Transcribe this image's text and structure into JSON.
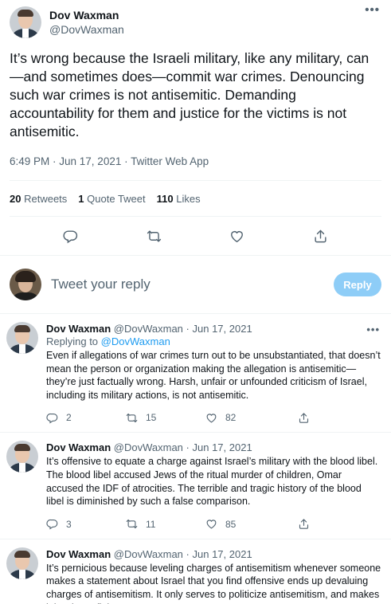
{
  "main_tweet": {
    "display_name": "Dov Waxman",
    "handle": "@DovWaxman",
    "more_label": "•••",
    "text": "It’s wrong because the Israeli military, like any military, can—and sometimes does—commit war crimes. Denouncing such war crimes is not antisemitic. Demanding accountability for them and justice for the victims is not antisemitic.",
    "meta": "6:49 PM · Jun 17, 2021 · Twitter Web App",
    "stats": {
      "retweets_count": "20",
      "retweets_label": "Retweets",
      "quotes_count": "1",
      "quotes_label": "Quote Tweet",
      "likes_count": "110",
      "likes_label": "Likes"
    },
    "action_icons": [
      "reply-icon",
      "retweet-icon",
      "like-icon",
      "share-icon"
    ]
  },
  "reply_box": {
    "placeholder": "Tweet your reply",
    "button_label": "Reply",
    "button_color": "#8ecdf7"
  },
  "replies": [
    {
      "name": "Dov Waxman",
      "handle": "@DovWaxman",
      "dot": "·",
      "date": "Jun 17, 2021",
      "replying_prefix": "Replying to",
      "replying_to": "@DovWaxman",
      "text": "Even if allegations of war crimes turn out to be unsubstantiated, that doesn’t mean the person or organization making the allegation is antisemitic—they’re just factually wrong. Harsh, unfair or unfounded criticism of Israel, including its military actions, is not antisemitic.",
      "replies": "2",
      "retweets": "15",
      "likes": "82"
    },
    {
      "name": "Dov Waxman",
      "handle": "@DovWaxman",
      "dot": "·",
      "date": "Jun 17, 2021",
      "text": "It’s offensive to equate a charge against Israel’s military with the blood libel. The blood libel accused Jews of the ritual murder of children, Omar accused the IDF of atrocities. The terrible and tragic history of the blood libel is diminished by such a false comparison.",
      "replies": "3",
      "retweets": "11",
      "likes": "85"
    },
    {
      "name": "Dov Waxman",
      "handle": "@DovWaxman",
      "dot": "·",
      "date": "Jun 17, 2021",
      "text": "It’s pernicious because leveling charges of antisemitism whenever someone makes a statement about Israel that you find offensive ends up devaluing charges of antisemitism. It only serves to politicize antisemitism, and makes it harder to fight."
    }
  ],
  "colors": {
    "link": "#1d9bf0",
    "secondary_text": "#536471",
    "divider": "#eff3f4"
  }
}
